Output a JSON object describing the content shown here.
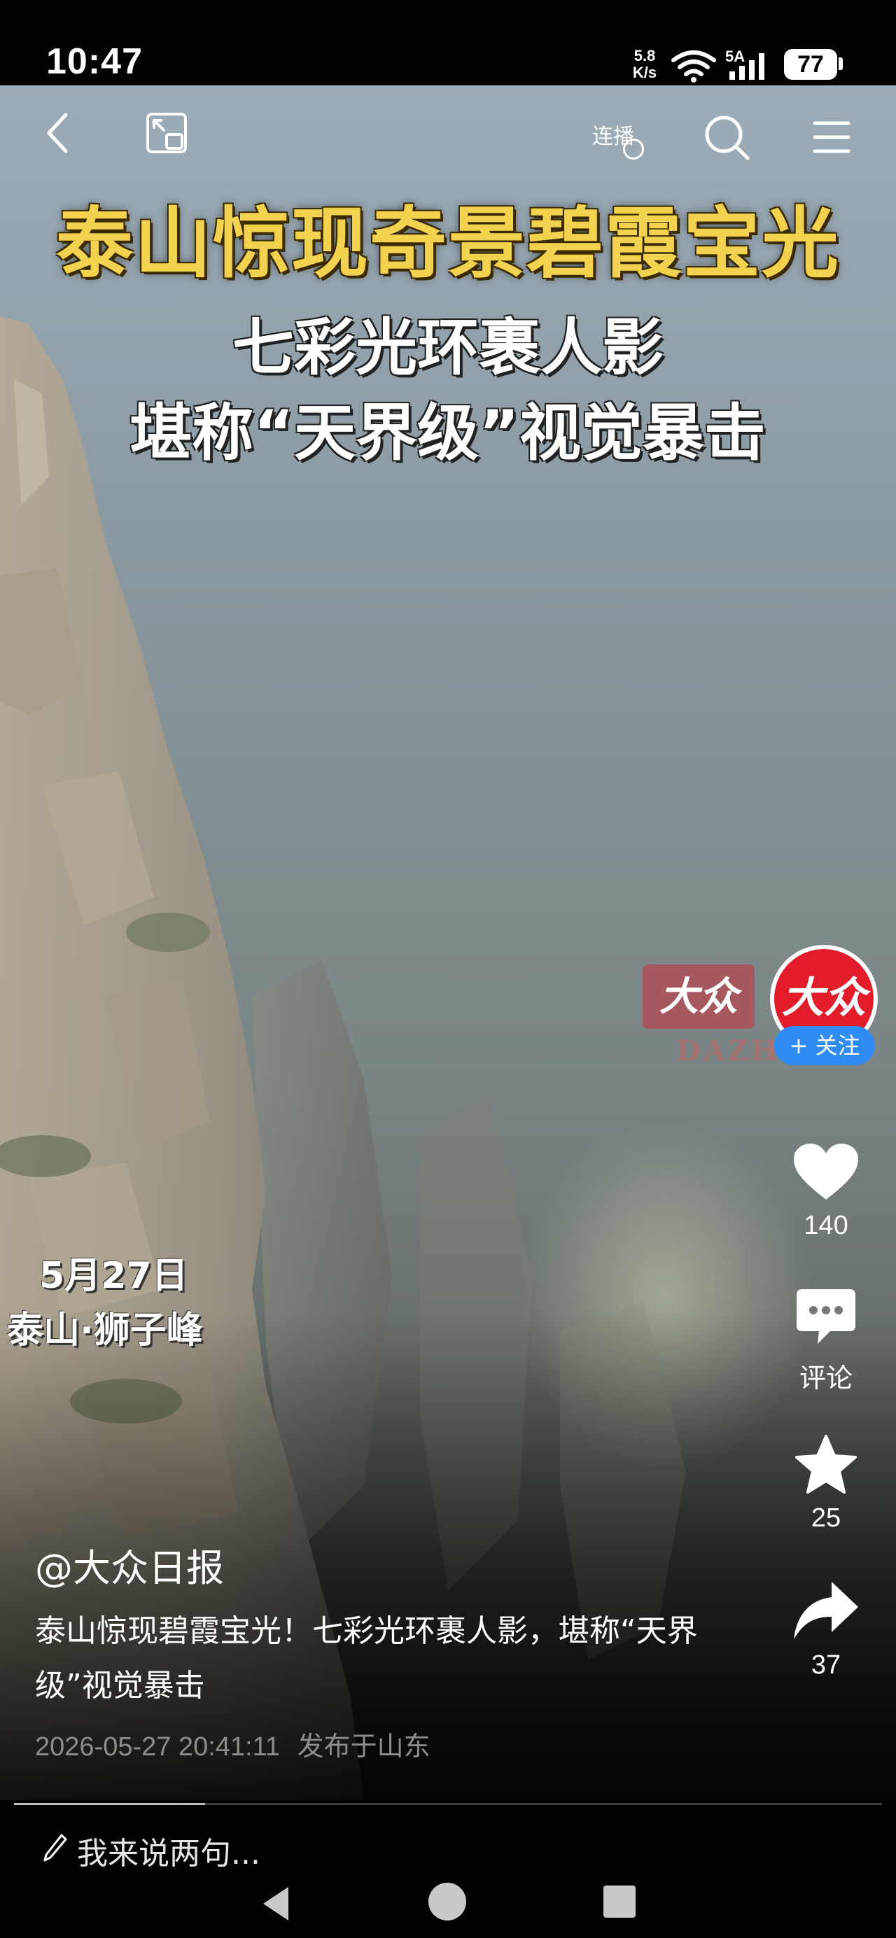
{
  "status_bar": {
    "time": "10:47",
    "net_speed_value": "5.8",
    "net_speed_unit": "K/s",
    "signal_label": "5A",
    "battery": "77"
  },
  "top_bar": {
    "live_toggle_label": "连播"
  },
  "video": {
    "headline_1": "泰山惊现奇景碧霞宝光",
    "headline_2": "七彩光环裹人影",
    "headline_3": "堪称“天界级”视觉暴击",
    "overlay_date": "5月27日",
    "overlay_place": "泰山·狮子峰",
    "watermark_logo": "大众",
    "watermark_text": "DAZH",
    "progress": 0.22
  },
  "actions": {
    "avatar_logo": "大众",
    "follow_label": "+ 关注",
    "like_count": "140",
    "comment_label": "评论",
    "favorite_count": "25",
    "share_count": "37"
  },
  "post": {
    "author": "@大众日报",
    "description": "泰山惊现碧霞宝光！七彩光环裹人影，堪称“天界级”视觉暴击",
    "timestamp": "2026-05-27 20:41:11",
    "location": "发布于山东"
  },
  "comment_bar": {
    "placeholder": "我来说两句..."
  },
  "colors": {
    "headline_yellow": "#f2d24e",
    "follow_blue": "#2f8cf5",
    "brand_red": "#e21c2a"
  },
  "icons": [
    "back-icon",
    "pip-icon",
    "search-icon",
    "menu-icon",
    "heart-icon",
    "comment-icon",
    "star-icon",
    "share-icon",
    "pencil-icon",
    "wifi-icon",
    "signal-icon"
  ]
}
